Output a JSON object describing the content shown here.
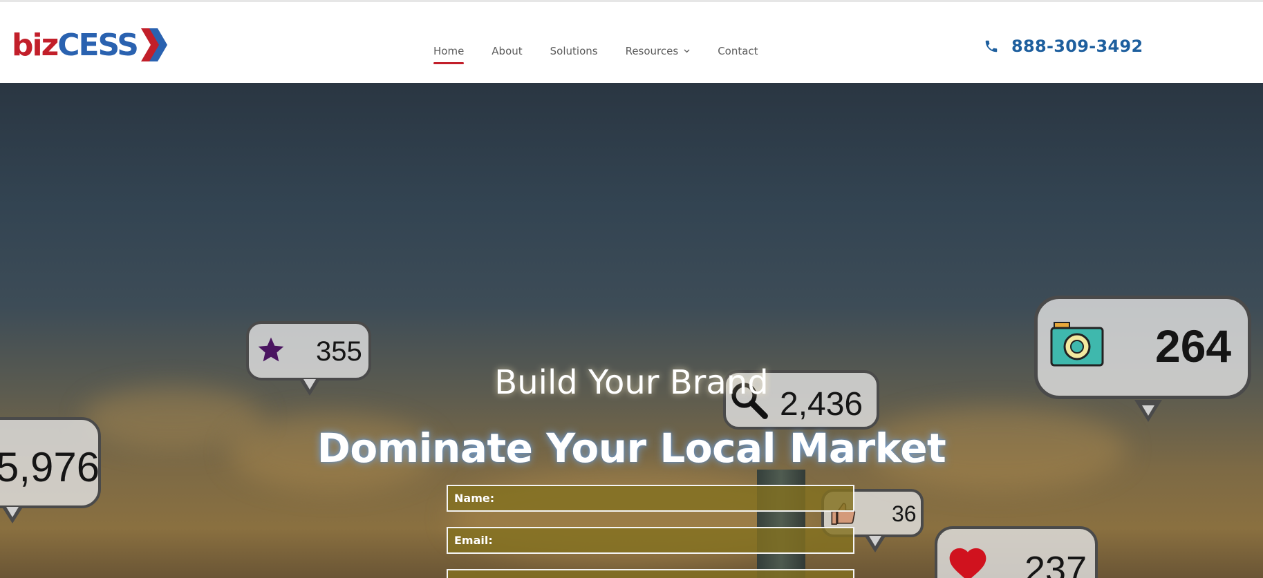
{
  "brand": {
    "logo_part1": "biz",
    "logo_part2": "CESS"
  },
  "nav": {
    "items": [
      {
        "label": "Home",
        "active": true
      },
      {
        "label": "About"
      },
      {
        "label": "Solutions"
      },
      {
        "label": "Resources",
        "has_dropdown": true
      },
      {
        "label": "Contact"
      }
    ]
  },
  "contact": {
    "phone": "888-309-3492"
  },
  "hero": {
    "subtitle": "Build Your Brand",
    "title": "Dominate Your Local Market",
    "bubbles": {
      "star": "355",
      "search": "2,436",
      "camera": "264",
      "left": "5,976",
      "like": "36",
      "heart": "237"
    }
  },
  "form": {
    "name_label": "Name:",
    "email_label": "Email:"
  },
  "colors": {
    "brand_red": "#c21f2a",
    "brand_blue": "#2a62b0",
    "phone_blue": "#1e5f9e",
    "field_fill": "#827020"
  }
}
